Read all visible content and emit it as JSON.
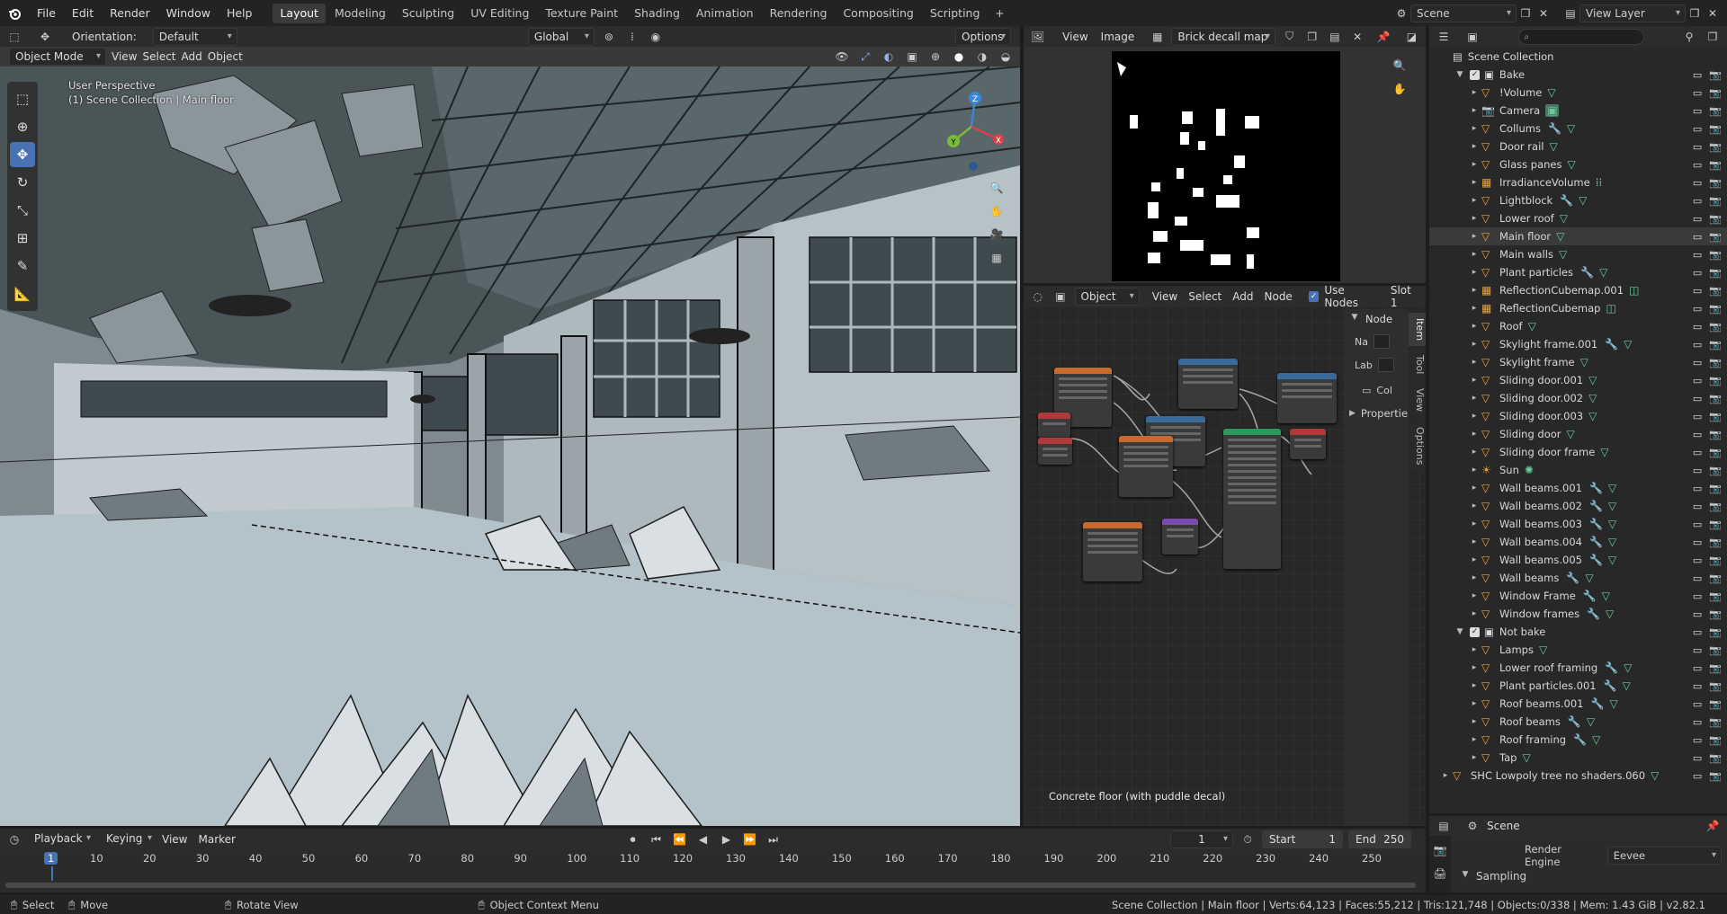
{
  "menu": {
    "file": "File",
    "edit": "Edit",
    "render": "Render",
    "window": "Window",
    "help": "Help"
  },
  "workspaces": [
    "Layout",
    "Modeling",
    "Sculpting",
    "UV Editing",
    "Texture Paint",
    "Shading",
    "Animation",
    "Rendering",
    "Compositing",
    "Scripting"
  ],
  "active_workspace": "Layout",
  "topright": {
    "scene": "Scene",
    "view_layer": "View Layer"
  },
  "viewport": {
    "orientation_label": "Orientation:",
    "orientation_value": "Default",
    "transform_space": "Global",
    "options": "Options",
    "mode": "Object Mode",
    "view": "View",
    "select": "Select",
    "add": "Add",
    "object": "Object",
    "overlay_line1": "User Perspective",
    "overlay_line2": "(1) Scene Collection | Main floor",
    "gizmo": {
      "x": "X",
      "y": "Y",
      "z": "Z"
    }
  },
  "image_editor": {
    "view": "View",
    "image": "Image",
    "image_name": "Brick decall map"
  },
  "node_editor": {
    "object": "Object",
    "view": "View",
    "select": "Select",
    "add": "Add",
    "node": "Node",
    "use_nodes": "Use Nodes",
    "slot": "Slot 1",
    "panel_node": "Node",
    "name_label": "Na",
    "label_label": "Lab",
    "color_label": "Col",
    "properties_label": "Propertie",
    "tabs": [
      "Item",
      "Tool",
      "View",
      "Options"
    ],
    "material_name": "Concrete floor (with puddle decal)"
  },
  "outliner": {
    "search_placeholder": "",
    "root": "Scene Collection",
    "items": [
      {
        "name": "Bake",
        "type": "collection",
        "indent": 1,
        "mods": []
      },
      {
        "name": "!Volume",
        "type": "mesh",
        "indent": 2,
        "mods": [
          "data"
        ]
      },
      {
        "name": "Camera",
        "type": "camera",
        "indent": 2,
        "mods": [
          "cam"
        ]
      },
      {
        "name": "Collums",
        "type": "mesh",
        "indent": 2,
        "mods": [
          "mod",
          "data"
        ]
      },
      {
        "name": "Door rail",
        "type": "mesh",
        "indent": 2,
        "mods": [
          "data"
        ]
      },
      {
        "name": "Glass panes",
        "type": "mesh",
        "indent": 2,
        "mods": [
          "data"
        ]
      },
      {
        "name": "IrradianceVolume",
        "type": "probe",
        "indent": 2,
        "mods": [
          "grid"
        ]
      },
      {
        "name": "Lightblock",
        "type": "mesh",
        "indent": 2,
        "mods": [
          "mod",
          "data"
        ]
      },
      {
        "name": "Lower roof",
        "type": "mesh",
        "indent": 2,
        "mods": [
          "data"
        ]
      },
      {
        "name": "Main floor",
        "type": "mesh",
        "indent": 2,
        "mods": [
          "data"
        ],
        "active": true
      },
      {
        "name": "Main walls",
        "type": "mesh",
        "indent": 2,
        "mods": [
          "data"
        ]
      },
      {
        "name": "Plant particles",
        "type": "mesh",
        "indent": 2,
        "mods": [
          "mod",
          "data"
        ]
      },
      {
        "name": "ReflectionCubemap.001",
        "type": "probe",
        "indent": 2,
        "mods": [
          "cube"
        ]
      },
      {
        "name": "ReflectionCubemap",
        "type": "probe",
        "indent": 2,
        "mods": [
          "cube"
        ]
      },
      {
        "name": "Roof",
        "type": "mesh",
        "indent": 2,
        "mods": [
          "data"
        ]
      },
      {
        "name": "Skylight frame.001",
        "type": "mesh",
        "indent": 2,
        "mods": [
          "mod",
          "data"
        ]
      },
      {
        "name": "Skylight frame",
        "type": "mesh",
        "indent": 2,
        "mods": [
          "data"
        ]
      },
      {
        "name": "Sliding door.001",
        "type": "mesh",
        "indent": 2,
        "mods": [
          "data"
        ]
      },
      {
        "name": "Sliding door.002",
        "type": "mesh",
        "indent": 2,
        "mods": [
          "data"
        ]
      },
      {
        "name": "Sliding door.003",
        "type": "mesh",
        "indent": 2,
        "mods": [
          "data"
        ]
      },
      {
        "name": "Sliding door",
        "type": "mesh",
        "indent": 2,
        "mods": [
          "data"
        ]
      },
      {
        "name": "Sliding door frame",
        "type": "mesh",
        "indent": 2,
        "mods": [
          "data"
        ]
      },
      {
        "name": "Sun",
        "type": "light",
        "indent": 2,
        "mods": [
          "sun"
        ]
      },
      {
        "name": "Wall beams.001",
        "type": "mesh",
        "indent": 2,
        "mods": [
          "mod",
          "data"
        ]
      },
      {
        "name": "Wall beams.002",
        "type": "mesh",
        "indent": 2,
        "mods": [
          "mod",
          "data"
        ]
      },
      {
        "name": "Wall beams.003",
        "type": "mesh",
        "indent": 2,
        "mods": [
          "mod",
          "data"
        ]
      },
      {
        "name": "Wall beams.004",
        "type": "mesh",
        "indent": 2,
        "mods": [
          "mod",
          "data"
        ]
      },
      {
        "name": "Wall beams.005",
        "type": "mesh",
        "indent": 2,
        "mods": [
          "mod",
          "data"
        ]
      },
      {
        "name": "Wall beams",
        "type": "mesh",
        "indent": 2,
        "mods": [
          "mod",
          "data"
        ]
      },
      {
        "name": "Window Frame",
        "type": "mesh",
        "indent": 2,
        "mods": [
          "mod",
          "data"
        ]
      },
      {
        "name": "Window frames",
        "type": "mesh",
        "indent": 2,
        "mods": [
          "mod",
          "data"
        ]
      },
      {
        "name": "Not bake",
        "type": "collection",
        "indent": 1,
        "mods": []
      },
      {
        "name": "Lamps",
        "type": "mesh",
        "indent": 2,
        "mods": [
          "data"
        ]
      },
      {
        "name": "Lower roof framing",
        "type": "mesh",
        "indent": 2,
        "mods": [
          "mod",
          "data"
        ]
      },
      {
        "name": "Plant particles.001",
        "type": "mesh",
        "indent": 2,
        "mods": [
          "mod",
          "data"
        ]
      },
      {
        "name": "Roof beams.001",
        "type": "mesh",
        "indent": 2,
        "mods": [
          "mod",
          "data"
        ]
      },
      {
        "name": "Roof beams",
        "type": "mesh",
        "indent": 2,
        "mods": [
          "mod",
          "data"
        ]
      },
      {
        "name": "Roof framing",
        "type": "mesh",
        "indent": 2,
        "mods": [
          "mod",
          "data"
        ]
      },
      {
        "name": "Tap",
        "type": "mesh",
        "indent": 2,
        "mods": [
          "data"
        ]
      },
      {
        "name": "SHC Lowpoly tree no shaders.060",
        "type": "mesh",
        "indent": 0,
        "mods": [
          "data"
        ]
      }
    ]
  },
  "properties": {
    "scene": "Scene",
    "render_engine_label": "Render Engine",
    "render_engine": "Eevee",
    "sampling": "Sampling"
  },
  "timeline": {
    "playback": "Playback",
    "keying": "Keying",
    "view": "View",
    "marker": "Marker",
    "current_frame": "1",
    "start_label": "Start",
    "start": "1",
    "end_label": "End",
    "end": "250",
    "ticks": [
      "1",
      "10",
      "20",
      "30",
      "40",
      "50",
      "60",
      "70",
      "80",
      "90",
      "100",
      "110",
      "120",
      "130",
      "140",
      "150",
      "160",
      "170",
      "180",
      "190",
      "200",
      "210",
      "220",
      "230",
      "240",
      "250"
    ]
  },
  "status": {
    "select": "Select",
    "move": "Move",
    "rotate": "Rotate View",
    "context": "Object Context Menu",
    "stats": "Scene Collection | Main floor | Verts:64,123 | Faces:55,212 | Tris:121,748 | Objects:0/338 | Mem: 1.43 GiB | v2.82.1"
  },
  "colors": {
    "accent": "#4772b3",
    "mesh": "#e8a43a",
    "data": "#66cc99",
    "modifier": "#6b9ce8"
  }
}
